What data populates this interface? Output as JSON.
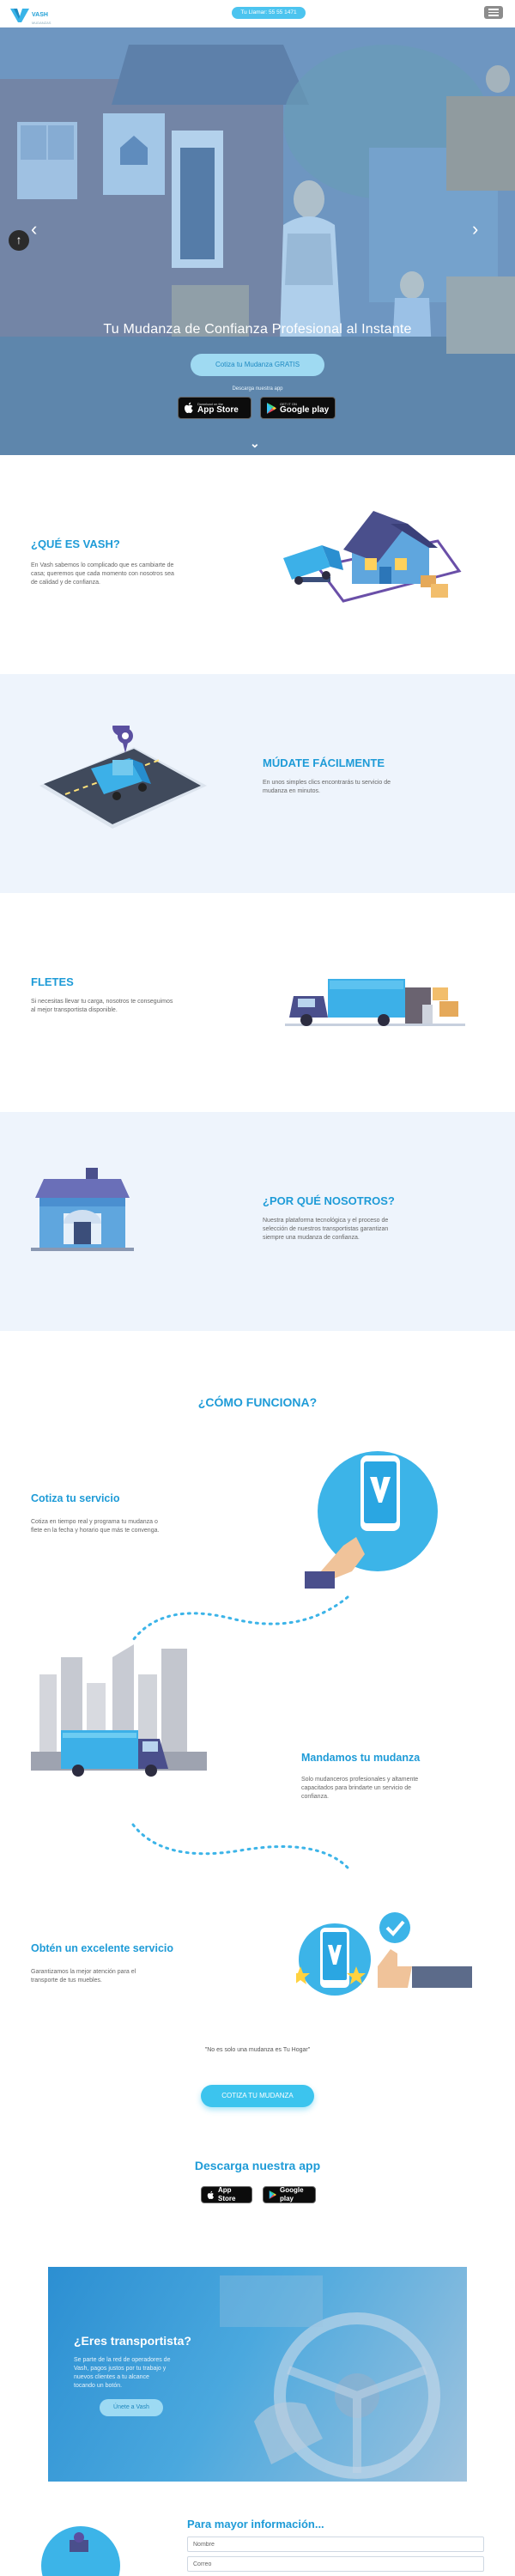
{
  "nav": {
    "logo_text": "VASH",
    "logo_sub": "MUDANZAS",
    "phone_label": "Tu Llamar: 55 55 1471",
    "menu_icon": "hamburger-icon"
  },
  "hero": {
    "title": "Tu Mudanza de Confianza Profesional al Instante",
    "cta_label": "Cotiza tu Mudanza GRATIS",
    "download_label": "Descarga nuestra app",
    "app_store_small": "Download on the",
    "app_store_big": "App Store",
    "google_play_small": "GET IT ON",
    "google_play_big": "Google play"
  },
  "sections": {
    "que_es": {
      "title": "¿QUÉ ES VASH?",
      "body": "En Vash sabemos lo complicado que es cambiarte de casa; queremos que cada momento con nosotros sea de calidad y de confianza."
    },
    "mudate": {
      "title": "MÚDATE FÁCILMENTE",
      "body": "En unos simples clics encontrarás tu servicio de mudanza en minutos."
    },
    "fletes": {
      "title": "FLETES",
      "body": "Si necesitas llevar tu carga, nosotros te conseguimos al mejor transportista disponible."
    },
    "por_que": {
      "title": "¿POR QUÉ NOSOTROS?",
      "body": "Nuestra plataforma tecnológica y el proceso de selección de nuestros transportistas garantizan siempre una mudanza de confianza."
    }
  },
  "how": {
    "title": "¿CÓMO FUNCIONA?",
    "steps": [
      {
        "title": "Cotiza tu servicio",
        "body": "Cotiza en tiempo real y programa tu mudanza o flete en la fecha y horario que más te convenga."
      },
      {
        "title": "Mandamos tu mudanza",
        "body": "Solo mudanceros profesionales y altamente capacitados para brindarte un servicio de confianza."
      },
      {
        "title": "Obtén un excelente servicio",
        "body": "Garantizamos la mejor atención para el transporte de tus muebles."
      }
    ]
  },
  "quote": "\"No es solo una mudanza es Tu Hogar\"",
  "cta_label": "COTIZA TU MUDANZA",
  "download_title": "Descarga nuestra app",
  "transportista": {
    "title": "¿Eres transportista?",
    "body": "Se parte de la red de operadores de Vash, pagos justos por tu trabajo y nuevos clientes a tu alcance tocando un botón.",
    "button": "Únete a Vash"
  },
  "info": {
    "title": "Para mayor información...",
    "name_placeholder": "Nombre",
    "email_placeholder": "Correo"
  },
  "colors": {
    "accent": "#1e9bd7",
    "button": "#3cc4ee",
    "alt_bg": "#eef4fc"
  }
}
